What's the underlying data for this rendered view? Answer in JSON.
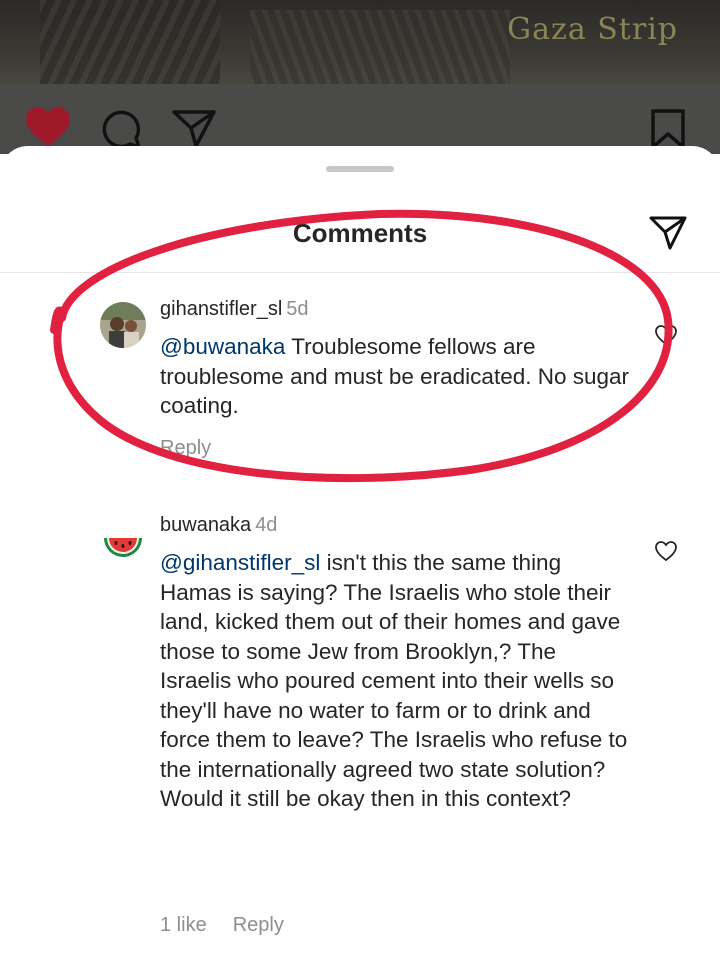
{
  "post": {
    "caption": "Gaza Strip"
  },
  "sheet": {
    "title": "Comments"
  },
  "comments": [
    {
      "username": "gihanstifler_sl",
      "time": "5d",
      "mention": "@buwanaka",
      "text": " Troublesome fellows are troublesome and must be eradicated. No sugar coating.",
      "reply_label": "Reply"
    },
    {
      "username": "buwanaka",
      "time": "4d",
      "mention": "@gihanstifler_sl",
      "text": " isn't this the same thing Hamas is saying? The Israelis who stole their land, kicked them out of their homes and gave those to some Jew from Brooklyn,? The Israelis who poured cement into their wells so they'll have no water to farm or to drink and force them to leave? The Israelis who refuse to the internationally agreed two state solution? Would it still be okay then in this context?",
      "likes_label": "1 like",
      "reply_label": "Reply"
    }
  ],
  "colors": {
    "like_red": "#9e1a2a",
    "annotation_red": "#e0213f",
    "mention_blue": "#00376b"
  },
  "icons": [
    "heart-icon",
    "comment-icon",
    "share-icon",
    "bookmark-icon",
    "like-comment-icon"
  ]
}
